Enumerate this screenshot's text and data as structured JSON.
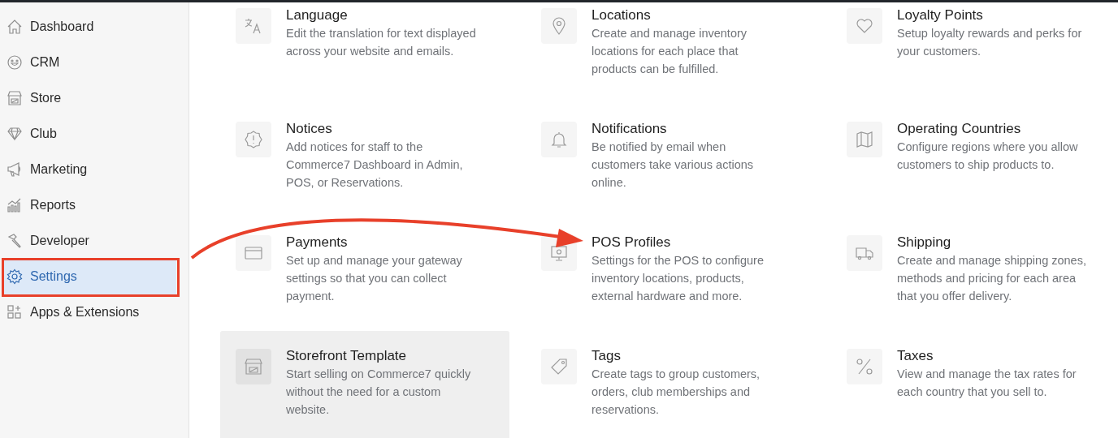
{
  "sidebar": {
    "items": [
      {
        "label": "Dashboard",
        "selected": false
      },
      {
        "label": "CRM",
        "selected": false
      },
      {
        "label": "Store",
        "selected": false
      },
      {
        "label": "Club",
        "selected": false
      },
      {
        "label": "Marketing",
        "selected": false
      },
      {
        "label": "Reports",
        "selected": false
      },
      {
        "label": "Developer",
        "selected": false
      },
      {
        "label": "Settings",
        "selected": true
      },
      {
        "label": "Apps & Extensions",
        "selected": false
      }
    ]
  },
  "settings_cards": [
    {
      "title": "Language",
      "description": "Edit the translation for text displayed across your website and emails.",
      "hovered": false
    },
    {
      "title": "Locations",
      "description": "Create and manage inventory locations for each place that products can be fulfilled.",
      "hovered": false
    },
    {
      "title": "Loyalty Points",
      "description": "Setup loyalty rewards and perks for your customers.",
      "hovered": false
    },
    {
      "title": "Notices",
      "description": "Add notices for staff to the Commerce7 Dashboard in Admin, POS, or Reservations.",
      "hovered": false
    },
    {
      "title": "Notifications",
      "description": "Be notified by email when customers take various actions online.",
      "hovered": false
    },
    {
      "title": "Operating Countries",
      "description": "Configure regions where you allow customers to ship products to.",
      "hovered": false
    },
    {
      "title": "Payments",
      "description": "Set up and manage your gateway settings so that you can collect payment.",
      "hovered": false
    },
    {
      "title": "POS Profiles",
      "description": "Settings for the POS to configure inventory locations, products, external hardware and more.",
      "hovered": false
    },
    {
      "title": "Shipping",
      "description": "Create and manage shipping zones, methods and pricing for each area that you offer delivery.",
      "hovered": false
    },
    {
      "title": "Storefront Template",
      "description": "Start selling on Commerce7 quickly without the need for a custom website.",
      "hovered": true
    },
    {
      "title": "Tags",
      "description": "Create tags to group customers, orders, club memberships and reservations.",
      "hovered": false
    },
    {
      "title": "Taxes",
      "description": "View and manage the tax rates for each country that you sell to.",
      "hovered": false
    }
  ]
}
